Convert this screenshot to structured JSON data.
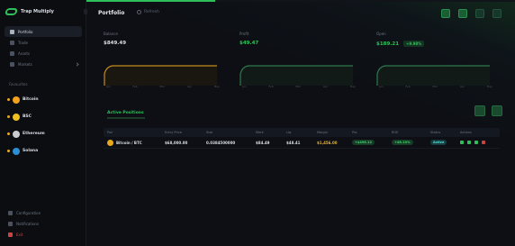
{
  "app": {
    "name": "Trap Multiply"
  },
  "progress_fraction": 0.3,
  "sidebar": {
    "items": [
      {
        "label": "Portfolio",
        "active": true
      },
      {
        "label": "Trade",
        "active": false
      },
      {
        "label": "Assets",
        "active": false
      },
      {
        "label": "Markets",
        "active": false,
        "expandable": true
      }
    ],
    "section_label": "Favourites",
    "chains": [
      {
        "label": "Bitcoin",
        "color": "#f2a21b"
      },
      {
        "label": "BSC",
        "color": "#f0c020"
      },
      {
        "label": "Ethereum",
        "color": "#c9ccd1"
      },
      {
        "label": "Solana",
        "color": "#2b8fd6"
      }
    ],
    "bottom": [
      {
        "label": "Configuration"
      },
      {
        "label": "Notifications"
      },
      {
        "label": "Exit"
      }
    ]
  },
  "header": {
    "title": "Portfolio",
    "refresh_label": "Refresh"
  },
  "stats": [
    {
      "label": "Balance",
      "value": "$849.49",
      "value_color": "#d8dde4",
      "change": ""
    },
    {
      "label": "Profit",
      "value": "$49.47",
      "value_color": "#2fbf5a",
      "change": ""
    },
    {
      "label": "Open",
      "value": "$189.21",
      "value_color": "#2fbf5a",
      "change": "+9.98%"
    }
  ],
  "chart_axis": [
    "Jan",
    "Feb",
    "Mar",
    "Apr",
    "May"
  ],
  "panel": {
    "title": "Active Positions"
  },
  "table": {
    "headers": [
      "Pair",
      "Entry Price",
      "Size",
      "Mark",
      "Liq.",
      "Margin",
      "PnL",
      "ROE",
      "Status",
      "Actions"
    ],
    "rows": [
      {
        "pair": "Bitcoin / BTC",
        "entry": "$68,000.00",
        "size": "0.0384500000",
        "mark": "$84.49",
        "liq": "$48.41",
        "margin": "$1,456.00",
        "pnl": "+$498.12",
        "roe": "+48.10%",
        "status": "Active"
      }
    ]
  },
  "colors": {
    "accent": "#2fbf5a",
    "orange": "#e8a91f",
    "teal": "#5ee0d6",
    "danger": "#c94444"
  }
}
